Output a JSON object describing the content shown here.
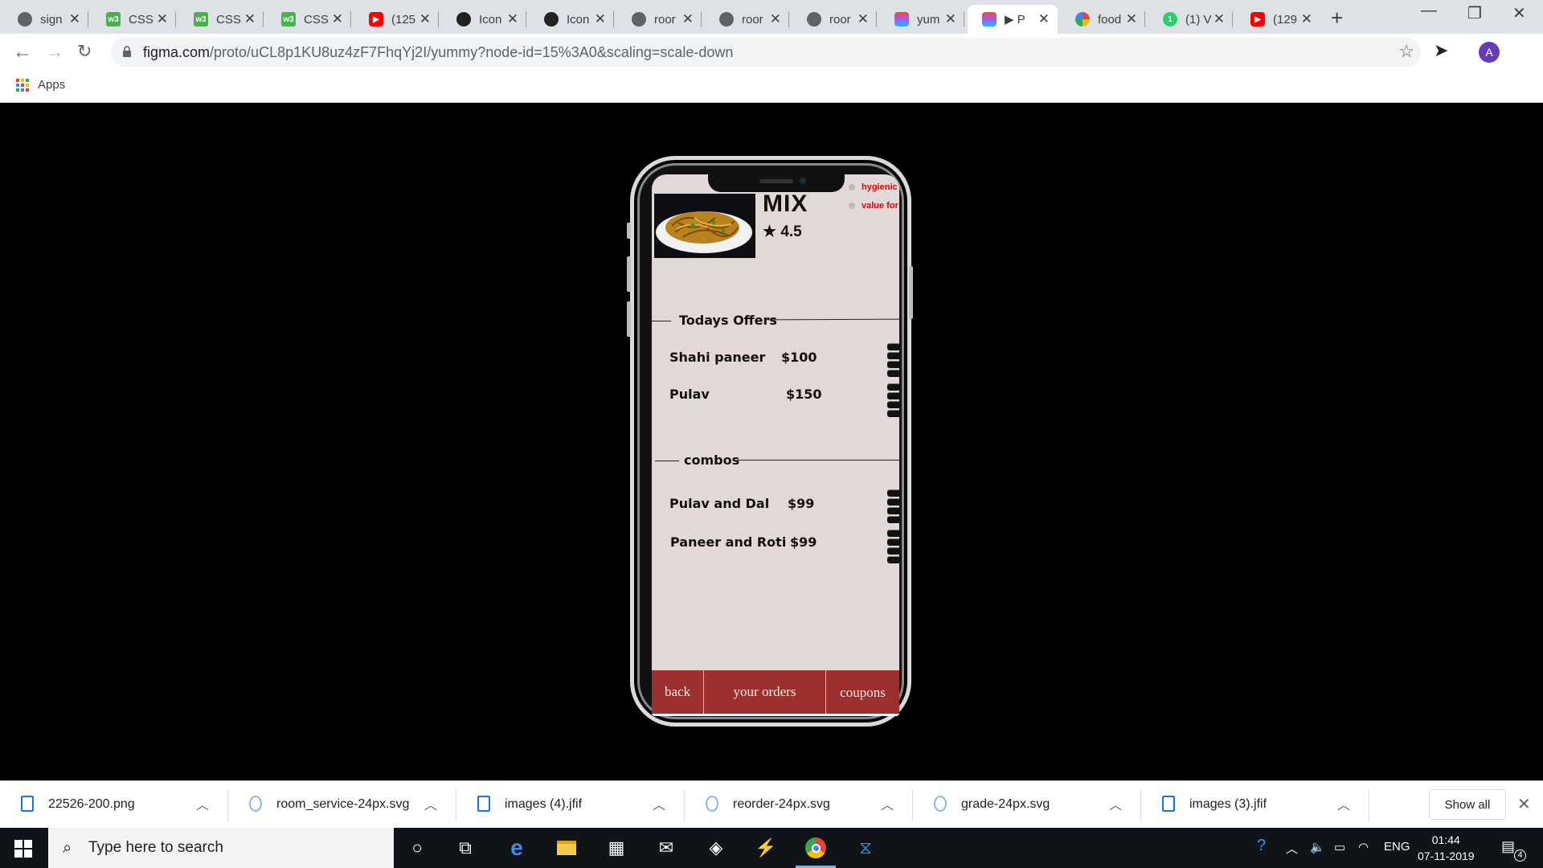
{
  "browser": {
    "tabs": [
      {
        "title": "sign",
        "favicon": "globe-icon",
        "active": false
      },
      {
        "title": "CSS",
        "favicon": "w3schools-icon",
        "active": false
      },
      {
        "title": "CSS",
        "favicon": "w3schools-icon",
        "active": false
      },
      {
        "title": "CSS",
        "favicon": "w3schools-icon",
        "active": false
      },
      {
        "title": "(125",
        "favicon": "youtube-icon",
        "active": false
      },
      {
        "title": "Icon",
        "favicon": "github-icon",
        "active": false
      },
      {
        "title": "Icon",
        "favicon": "github-icon",
        "active": false
      },
      {
        "title": "roor",
        "favicon": "globe-icon",
        "active": false
      },
      {
        "title": "roor",
        "favicon": "globe-icon",
        "active": false
      },
      {
        "title": "roor",
        "favicon": "globe-icon",
        "active": false
      },
      {
        "title": "yum",
        "favicon": "figma-icon",
        "active": false
      },
      {
        "title": "▶ P",
        "favicon": "figma-icon",
        "active": true
      },
      {
        "title": "food",
        "favicon": "google-icon",
        "active": false
      },
      {
        "title": "(1) V",
        "favicon": "whatsapp-icon",
        "active": false
      },
      {
        "title": "(129",
        "favicon": "youtube-icon",
        "active": false
      }
    ],
    "url_host": "figma.com",
    "url_path": "/proto/uCL8p1KU8uz4zF7FhqYj2I/yummy?node-id=15%3A0&scaling=scale-down",
    "profile_initial": "A",
    "bookmarks_label": "Apps"
  },
  "app": {
    "dish_title": "MIX",
    "rating": "4.5",
    "features": [
      "hygienic",
      "value for"
    ],
    "offers_title": "Todays Offers",
    "offers": [
      {
        "name": "Shahi paneer",
        "price": "$100"
      },
      {
        "name": "Pulav",
        "price": "$150"
      }
    ],
    "combos_title": "combos",
    "combos": [
      {
        "name": "Pulav and Dal",
        "price": "$99"
      },
      {
        "name": "Paneer and Roti",
        "price": "$99"
      }
    ],
    "nav": {
      "back": "back",
      "orders": "your orders",
      "coupons": "coupons"
    },
    "colors": {
      "screen_bg": "#e3d8d8",
      "nav_bg": "#9e2f2f",
      "feature_text": "#e00000"
    }
  },
  "downloads": {
    "files": [
      "22526-200.png",
      "room_service-24px.svg",
      "images (4).jfif",
      "reorder-24px.svg",
      "grade-24px.svg",
      "images (3).jfif"
    ],
    "show_all": "Show all"
  },
  "taskbar": {
    "search_placeholder": "Type here to search",
    "language": "ENG",
    "time": "01:44",
    "date": "07-11-2019",
    "notification_count": "4"
  }
}
